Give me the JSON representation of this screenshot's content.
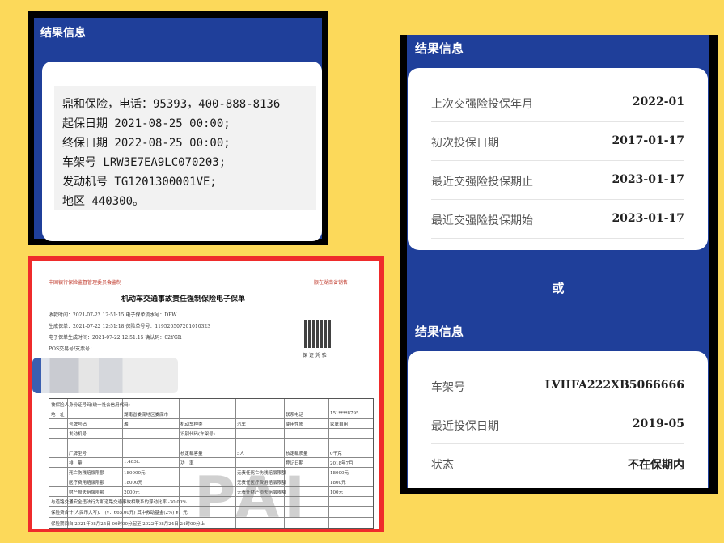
{
  "card_a": {
    "header": "结果信息",
    "lines": [
      "鼎和保险，电话：95393，400-888-8136",
      "起保日期 2021-08-25 00:00;",
      "终保日期 2022-08-25 00:00;",
      "车架号 LRW3E7EA9LC070203;",
      "发动机号 TG1201300001VE;",
      "地区 440300。"
    ]
  },
  "document": {
    "top_left": "中国银行保险监督管理委员会监制",
    "top_right": "限在湖南省销售",
    "title": "机动车交通事故责任强制保险电子保单",
    "meta": [
      "收款时间：2021-07-22 12:51:15   电子保单流水号：DPW",
      "生成保单：2021-07-22 12:51:18   保险单号号：119520507201010323",
      "电子保单生成时间：2021-07-22 12:51:15   确认码：02YGR",
      "POS交易号/支票号："
    ],
    "qr_caption": "保 证 凭 验",
    "table_cells": [
      "被保险人身份证号码(统一社会信用代码)",
      "地　址",
      "湖南省娄底地区娄底市",
      "联系电话",
      "151****8795",
      "号牌号码",
      "湘",
      "机动车种类",
      "汽车",
      "使用性质",
      "家庭自用",
      "发动机号",
      "识别代码(车架号)",
      "厂牌型号",
      "核定载客量",
      "5人",
      "核定载质量",
      "0千克",
      "排　量",
      "1.485L",
      "功　率",
      "登记日期",
      "2018年7月",
      "死亡伤残赔偿限额",
      "180000元",
      "无责任死亡伤残赔偿限额",
      "18000元",
      "医疗费用赔偿限额",
      "18000元",
      "无责任医疗费用赔偿限额",
      "1800元",
      "财产损失赔偿限额",
      "2000元",
      "无责任财产损失赔偿限额",
      "100元"
    ],
    "footer": [
      "与道路交通安全违法行为和道路交通事故相联系的浮动比率 -30.00%",
      "保险费合计(人民币大写)：   (¥：665.00元)   其中救助基金(2%) ¥：元",
      "保险期间自 2021年08月25日 00时00分起至 2022年08月24日 24时00分止"
    ]
  },
  "right_panel": {
    "section1_title": "结果信息",
    "section1_rows": [
      {
        "label": "上次交强险投保年月",
        "value": "2022-01"
      },
      {
        "label": "初次投保日期",
        "value": "2017-01-17"
      },
      {
        "label": "最近交强险投保期止",
        "value": "2023-01-17"
      },
      {
        "label": "最近交强险投保期始",
        "value": "2023-01-17"
      }
    ],
    "or_label": "或",
    "section2_title": "结果信息",
    "section2_rows": [
      {
        "label": "车架号",
        "value": "LVHFA222XB5066666"
      },
      {
        "label": "最近投保日期",
        "value": "2019-05"
      },
      {
        "label": "状态",
        "value": "不在保期内"
      }
    ]
  }
}
